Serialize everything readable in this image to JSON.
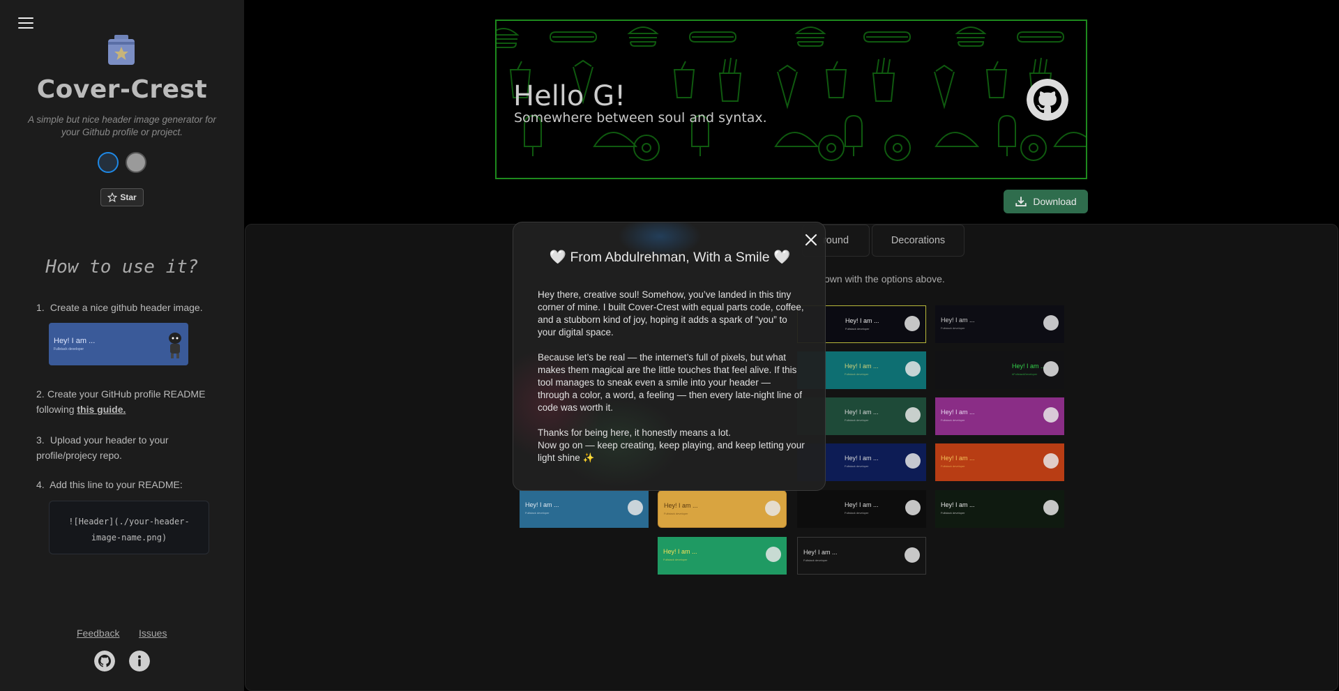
{
  "sidebar": {
    "app_title": "Cover-Crest",
    "app_subtitle": "A simple but nice header image generator for your Github profile or project.",
    "star_label": "Star",
    "how_title": "How to use it?",
    "steps": [
      {
        "num": "1.",
        "text": "Create a nice github header image."
      },
      {
        "num": "2.",
        "text_before": "Create your GitHub profile README following ",
        "link": "this guide."
      },
      {
        "num": "3.",
        "text": "Upload your header to your profile/projecy repo."
      },
      {
        "num": "4.",
        "text": "Add this line to your README:"
      }
    ],
    "sample": {
      "title": "Hey! I am ...",
      "subtitle": "Fullstack developer"
    },
    "code_snippet": "![Header](./your-header-image-name.png)",
    "feedback_link": "Feedback",
    "issues_link": "Issues"
  },
  "banner": {
    "title": "Hello G!",
    "subtitle": "Somewhere between soul and syntax."
  },
  "download_label": "Download",
  "tabs": [
    {
      "label": "round"
    },
    {
      "label": "Decorations"
    }
  ],
  "hint_text": "own with the options above.",
  "thumbnails": [
    {
      "title": "Hey! I am ...",
      "subtitle": "Fullstack developer",
      "bg": "#0b0b12",
      "color": "#e6e6e6",
      "border": "#b8b83a"
    },
    {
      "title": "Hey! I am ...",
      "subtitle": "Fullstack developer",
      "bg": "#0d0d14",
      "color": "#ccc",
      "border": "none"
    },
    {
      "title": "Hey! I am ...",
      "subtitle": "Fullstack developer",
      "bg": "#0e6f72",
      "color": "#cfd27a",
      "border": "none"
    },
    {
      "title": "Hey! I am ...",
      "subtitle": "#FullstackDeveloper",
      "bg": "#121214",
      "color": "#33d04a",
      "border": "none"
    },
    {
      "title": "Hey! I am ...",
      "subtitle": "Fullstack developer",
      "bg": "#1e4a38",
      "color": "#d8d8d8",
      "border": "none"
    },
    {
      "title": "Hey! I am ...",
      "subtitle": "Fullstack developer",
      "bg": "#8a2d86",
      "color": "#e8d8f0",
      "border": "none"
    },
    {
      "title": "Hey! I am ...",
      "subtitle": "Fullstack developer",
      "bg": "#0d1c55",
      "color": "#ddd",
      "border": "none"
    },
    {
      "title": "Hey! I am ...",
      "subtitle": "Fullstack developer",
      "bg": "#b83d14",
      "color": "#f4c45a",
      "border": "none"
    },
    {
      "title": "Hey! I am ...",
      "subtitle": "Fullstack developer",
      "bg": "#2a6b92",
      "color": "#e0e8f0",
      "border": "none"
    },
    {
      "title": "Hey! I am ...",
      "subtitle": "Fullstack developer",
      "bg": "#d9a440",
      "color": "#5a3a10",
      "border": "#c08a30"
    },
    {
      "title": "Hey! I am ...",
      "subtitle": "Fullstack developer",
      "bg": "#0d0d0d",
      "color": "#ddd",
      "border": "none"
    },
    {
      "title": "Hey! I am ...",
      "subtitle": "Fullstack developer",
      "bg": "#0f1a10",
      "color": "#e8e8e8",
      "border": "none"
    },
    {
      "title": "Hey! I am ...",
      "subtitle": "Fullstack developer",
      "bg": "#1f9a63",
      "color": "#f2e05a",
      "border": "none"
    },
    {
      "title": "Hey! I am ...",
      "subtitle": "Fullstack developer",
      "bg": "#141414",
      "color": "#ddd",
      "border": "#3a3a3a"
    }
  ],
  "modal": {
    "title": "🤍 From Abdulrehman, With a Smile 🤍",
    "paragraphs": [
      "Hey there, creative soul! Somehow, you’ve landed in this tiny corner of mine. I built Cover-Crest with equal parts code, coffee, and a stubborn kind of joy, hoping it adds a spark of “you” to your digital space.",
      "Because let’s be real — the internet’s full of pixels, but what makes them magical are the little touches that feel alive. If this tool manages to sneak even a smile into your header — through a color, a word, a feeling — then every late-night line of code was worth it.",
      "Thanks for being here, it honestly means a lot.",
      "Now go on — keep creating, keep playing, and keep letting your light shine ✨"
    ]
  },
  "colors": {
    "sidebar_bg": "#1c1c1c",
    "banner_border": "#1d8a1d",
    "pattern": "#0f5a0f",
    "download_bg": "#2f6d4d",
    "accent_blue": "#1e88e5"
  },
  "icons": [
    "menu-icon",
    "logo-icon",
    "star-icon",
    "github-icon",
    "info-icon",
    "download-icon",
    "close-icon",
    "heart-icon"
  ]
}
